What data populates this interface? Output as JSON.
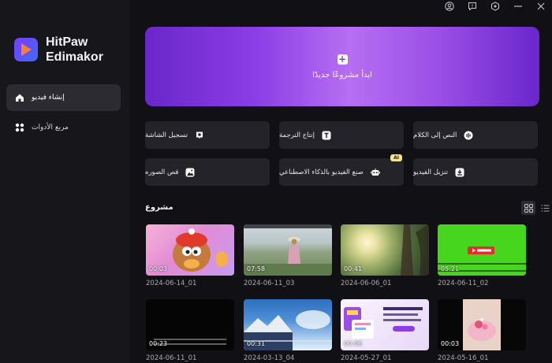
{
  "app": {
    "name_line1": "HitPaw",
    "name_line2": "Edimakor"
  },
  "sidebar": {
    "items": [
      {
        "label": "إنشاء فيديو",
        "icon": "home-icon",
        "active": true
      },
      {
        "label": "مربع الأدوات",
        "icon": "toolbox-icon",
        "active": false
      }
    ]
  },
  "topbar": {
    "icons": [
      "user-icon",
      "feedback-icon",
      "settings-icon",
      "menu-icon",
      "minimize-icon",
      "close-icon"
    ]
  },
  "hero": {
    "label": "ابدأ مشروعًا جديدًا"
  },
  "tools": [
    {
      "label": "تسجيل الشاشة",
      "icon": "screen-record-icon"
    },
    {
      "label": "إنتاج الترجمة",
      "icon": "subtitle-icon"
    },
    {
      "label": "النص إلى الكلام",
      "icon": "text-to-speech-icon"
    },
    {
      "label": "قص الصوره",
      "icon": "image-crop-icon"
    },
    {
      "label": "صنع الفيديو بالذكاء الاصطناعي",
      "icon": "ai-robot-icon",
      "badge": "AI"
    },
    {
      "label": "تنزيل الفيديو",
      "icon": "download-icon"
    }
  ],
  "projects": {
    "title": "مشروع",
    "view_modes": [
      "grid-view-icon",
      "list-view-icon"
    ],
    "items": [
      {
        "name": "2024-06-14_01",
        "duration": "00:03",
        "thumb": "cartoon"
      },
      {
        "name": "2024-06-11_03",
        "duration": "07:58",
        "thumb": "field"
      },
      {
        "name": "2024-06-06_01",
        "duration": "00:41",
        "thumb": "sun"
      },
      {
        "name": "2024-06-11_02",
        "duration": "05:21",
        "thumb": "green"
      },
      {
        "name": "2024-06-11_01",
        "duration": "00:23",
        "thumb": "black"
      },
      {
        "name": "2024-03-13_04",
        "duration": "00:31",
        "thumb": "mountain"
      },
      {
        "name": "2024-05-27_01",
        "duration": "00:06",
        "thumb": "web"
      },
      {
        "name": "2024-05-16_01",
        "duration": "00:03",
        "thumb": "cake"
      }
    ]
  }
}
